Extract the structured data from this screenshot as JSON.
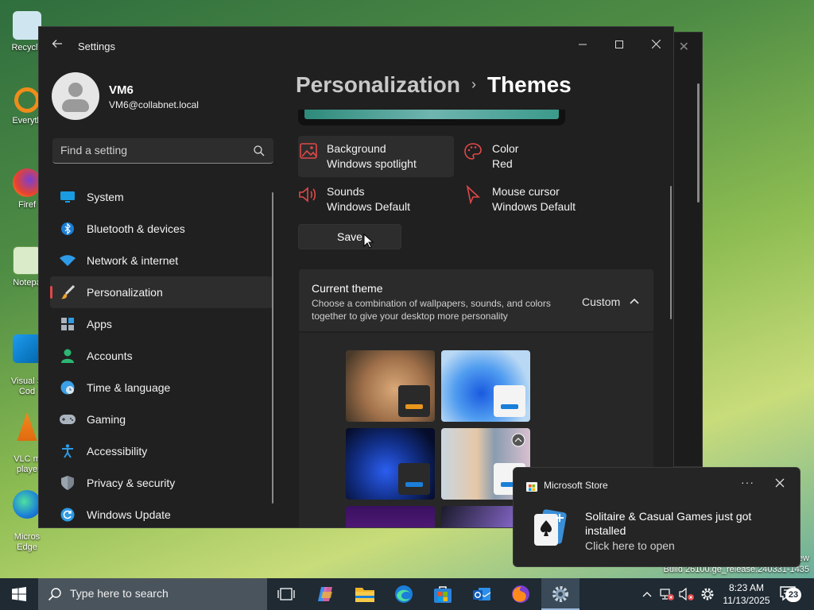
{
  "desktop": {
    "icons": [
      {
        "label": "Recycle",
        "icon": "recycle-bin-icon"
      },
      {
        "label": "Everyth",
        "icon": "everything-search-icon"
      },
      {
        "label": "Firef",
        "icon": "firefox-icon"
      },
      {
        "label": "Notepa",
        "icon": "notepad-icon"
      },
      {
        "label": "Visual S\nCod",
        "icon": "vscode-icon"
      },
      {
        "label": "VLC m\nplaye",
        "icon": "vlc-icon"
      },
      {
        "label": "Micros\nEdge",
        "icon": "edge-icon"
      }
    ],
    "build_text_line1": "ew",
    "build_text_line2": "Build 26100.ge_release.240331-1435"
  },
  "settings": {
    "app_title": "Settings",
    "user": {
      "name": "VM6",
      "email": "VM6@collabnet.local"
    },
    "search_placeholder": "Find a setting",
    "nav": [
      {
        "label": "System",
        "icon": "system-monitor-icon"
      },
      {
        "label": "Bluetooth & devices",
        "icon": "bluetooth-icon"
      },
      {
        "label": "Network & internet",
        "icon": "wifi-icon"
      },
      {
        "label": "Personalization",
        "icon": "paintbrush-icon",
        "active": true
      },
      {
        "label": "Apps",
        "icon": "apps-icon"
      },
      {
        "label": "Accounts",
        "icon": "accounts-icon"
      },
      {
        "label": "Time & language",
        "icon": "globe-clock-icon"
      },
      {
        "label": "Gaming",
        "icon": "gamepad-icon"
      },
      {
        "label": "Accessibility",
        "icon": "accessibility-icon"
      },
      {
        "label": "Privacy & security",
        "icon": "shield-icon"
      },
      {
        "label": "Windows Update",
        "icon": "update-icon"
      }
    ],
    "breadcrumb": {
      "parent": "Personalization",
      "separator": "›",
      "current": "Themes"
    },
    "tiles": {
      "background": {
        "title": "Background",
        "value": "Windows spotlight"
      },
      "color": {
        "title": "Color",
        "value": "Red"
      },
      "sounds": {
        "title": "Sounds",
        "value": "Windows Default"
      },
      "cursor": {
        "title": "Mouse cursor",
        "value": "Windows Default"
      }
    },
    "save_label": "Save",
    "current_theme": {
      "title": "Current theme",
      "description": "Choose a combination of wallpapers, sounds, and colors together to give your desktop more personality",
      "value": "Custom"
    }
  },
  "toast": {
    "app_name": "Microsoft Store",
    "more_label": "···",
    "message": "Solitaire & Casual Games just got installed",
    "subtext": "Click here to open"
  },
  "taskbar": {
    "search_placeholder": "Type here to search",
    "time": "8:23 AM",
    "date": "11/13/2025",
    "notification_count": "23"
  },
  "colors": {
    "accent_red": "#e04848",
    "window_bg": "#202020",
    "taskbar_bg": "#1f2a33"
  }
}
